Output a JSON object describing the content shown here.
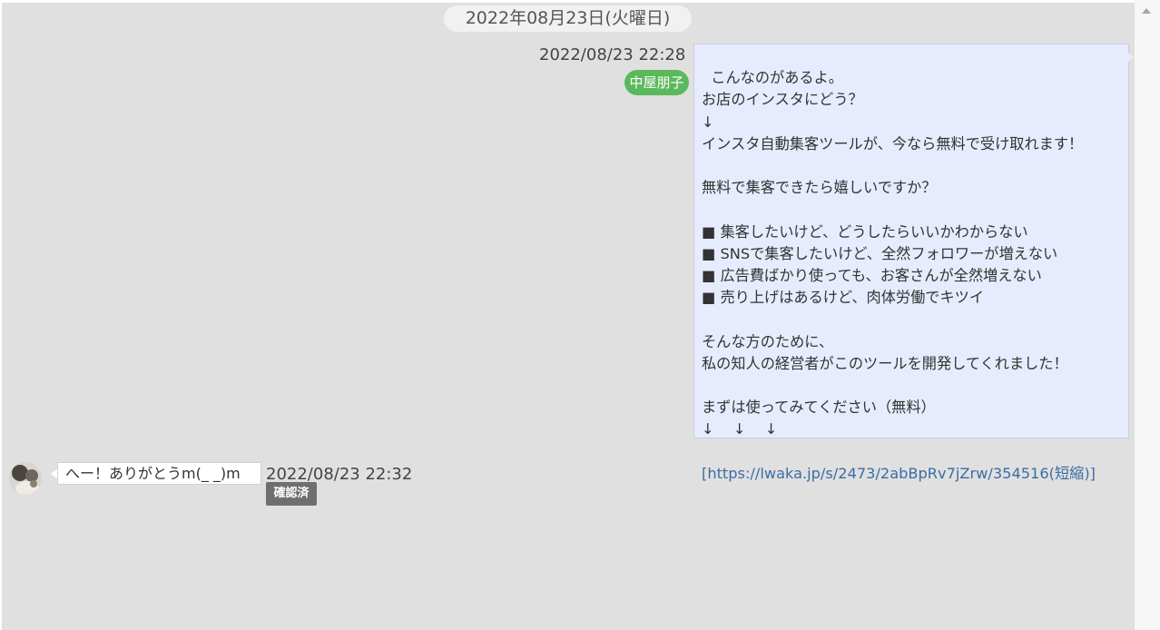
{
  "date_separator": "2022年08月23日(火曜日)",
  "outgoing_message": {
    "timestamp": "2022/08/23 22:28",
    "sender": "中屋朋子",
    "text": "こんなのがあるよ。\nお店のインスタにどう？\n↓\nインスタ自動集客ツールが、今なら無料で受け取れます！\n\n無料で集客できたら嬉しいですか？\n\n■ 集客したいけど、どうしたらいいかわからない\n■ SNSで集客したいけど、全然フォロワーが増えない\n■ 広告費ばかり使っても、お客さんが全然増えない\n■ 売り上げはあるけど、肉体労働でキツイ\n\nそんな方のために、\n私の知人の経営者がこのツールを開発してくれました！\n\nまずは使ってみてください（無料）\n↓　 ↓　 ↓",
    "link": "[https://lwaka.jp/s/2473/2abBpRv7jZrw/354516(短縮)]"
  },
  "incoming_message": {
    "text": "へー！ありがとうm(_ _)m",
    "timestamp": "2022/08/23 22:32",
    "status": "確認済"
  },
  "colors": {
    "chat_background": "#e0e0e0",
    "outgoing_bubble": "#e6ecfd",
    "sender_badge": "#5cb85c",
    "read_badge": "#6f6f6f",
    "link": "#3a6da5"
  }
}
